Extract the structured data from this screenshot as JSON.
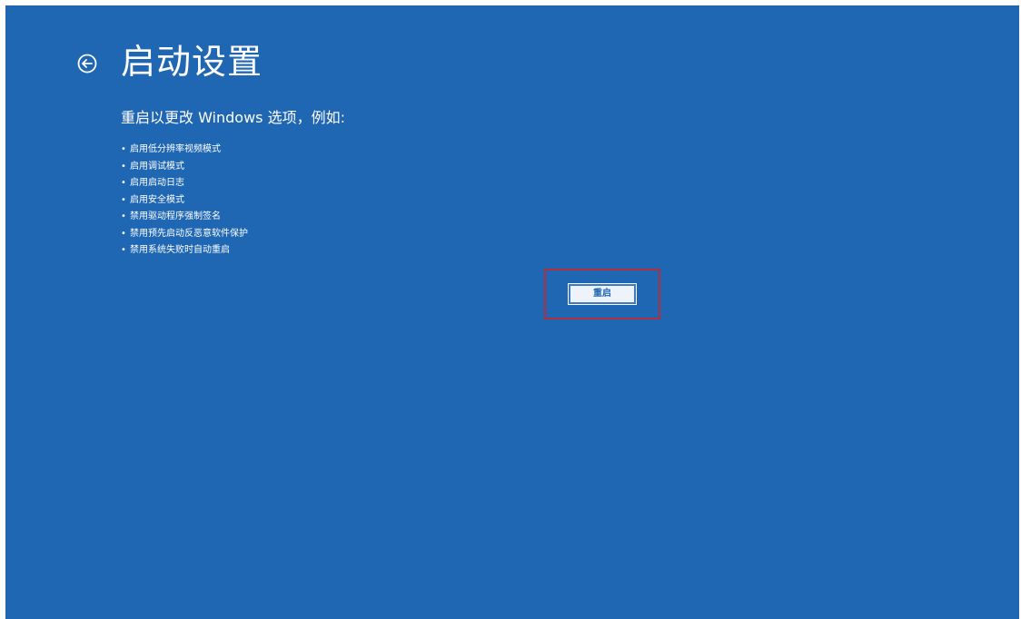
{
  "header": {
    "back_icon": "back-arrow-circle-icon",
    "title": "启动设置"
  },
  "main": {
    "intro": "重启以更改 Windows 选项，例如:",
    "options": [
      "启用低分辨率视频模式",
      "启用调试模式",
      "启用启动日志",
      "启用安全模式",
      "禁用驱动程序强制签名",
      "禁用预先启动反恶意软件保护",
      "禁用系统失败时自动重启"
    ],
    "bullet": "•",
    "restart_label": "重启"
  },
  "colors": {
    "background": "#1f67b3",
    "highlight_border": "#b0303f",
    "text": "#ffffff"
  }
}
